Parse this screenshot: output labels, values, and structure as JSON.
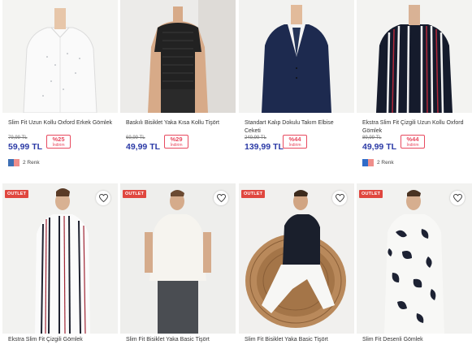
{
  "products_top": [
    {
      "title": "Slim Fit Uzun Kollu Oxford Erkek Gömlek",
      "old_price": "79,99 TL",
      "price": "59,99 TL",
      "discount": "%25",
      "discount_label": "İndirim",
      "colors_label": "2 Renk",
      "swatches": [
        "#3e6fb4",
        "#ef8e8b"
      ]
    },
    {
      "title": "Baskılı Bisiklet Yaka Kısa Kollu Tişört",
      "old_price": "69,99 TL",
      "price": "49,99 TL",
      "discount": "%29",
      "discount_label": "İndirim"
    },
    {
      "title": "Standart Kalıp Dokulu Takım Elbise Ceketi",
      "old_price": "249,99 TL",
      "price": "139,99 TL",
      "discount": "%44",
      "discount_label": "İndirim"
    },
    {
      "title": "Ekstra Slim Fit Çizgili Uzun Kollu Oxford Gömlek",
      "old_price": "89,99 TL",
      "price": "49,99 TL",
      "discount": "%44",
      "discount_label": "İndirim",
      "colors_label": "2 Renk",
      "swatches": [
        "#2f6cc9",
        "#ef8e8b"
      ]
    }
  ],
  "products_bottom": [
    {
      "badge": "OUTLET",
      "title": "Ekstra Slim Fit Çizgili Gömlek"
    },
    {
      "badge": "OUTLET",
      "title": "Slim Fit Bisiklet Yaka Basic Tişört"
    },
    {
      "badge": "OUTLET",
      "title": "Slim Fit Bisiklet Yaka Basic Tişört"
    },
    {
      "badge": "OUTLET",
      "title": "Slim Fit Desenli Gömlek"
    }
  ],
  "icons": {
    "favorite": "heart-outline-icon"
  },
  "colors": {
    "price": "#2b3aa6",
    "discount": "#e84a5f",
    "outlet": "#e0473f"
  }
}
